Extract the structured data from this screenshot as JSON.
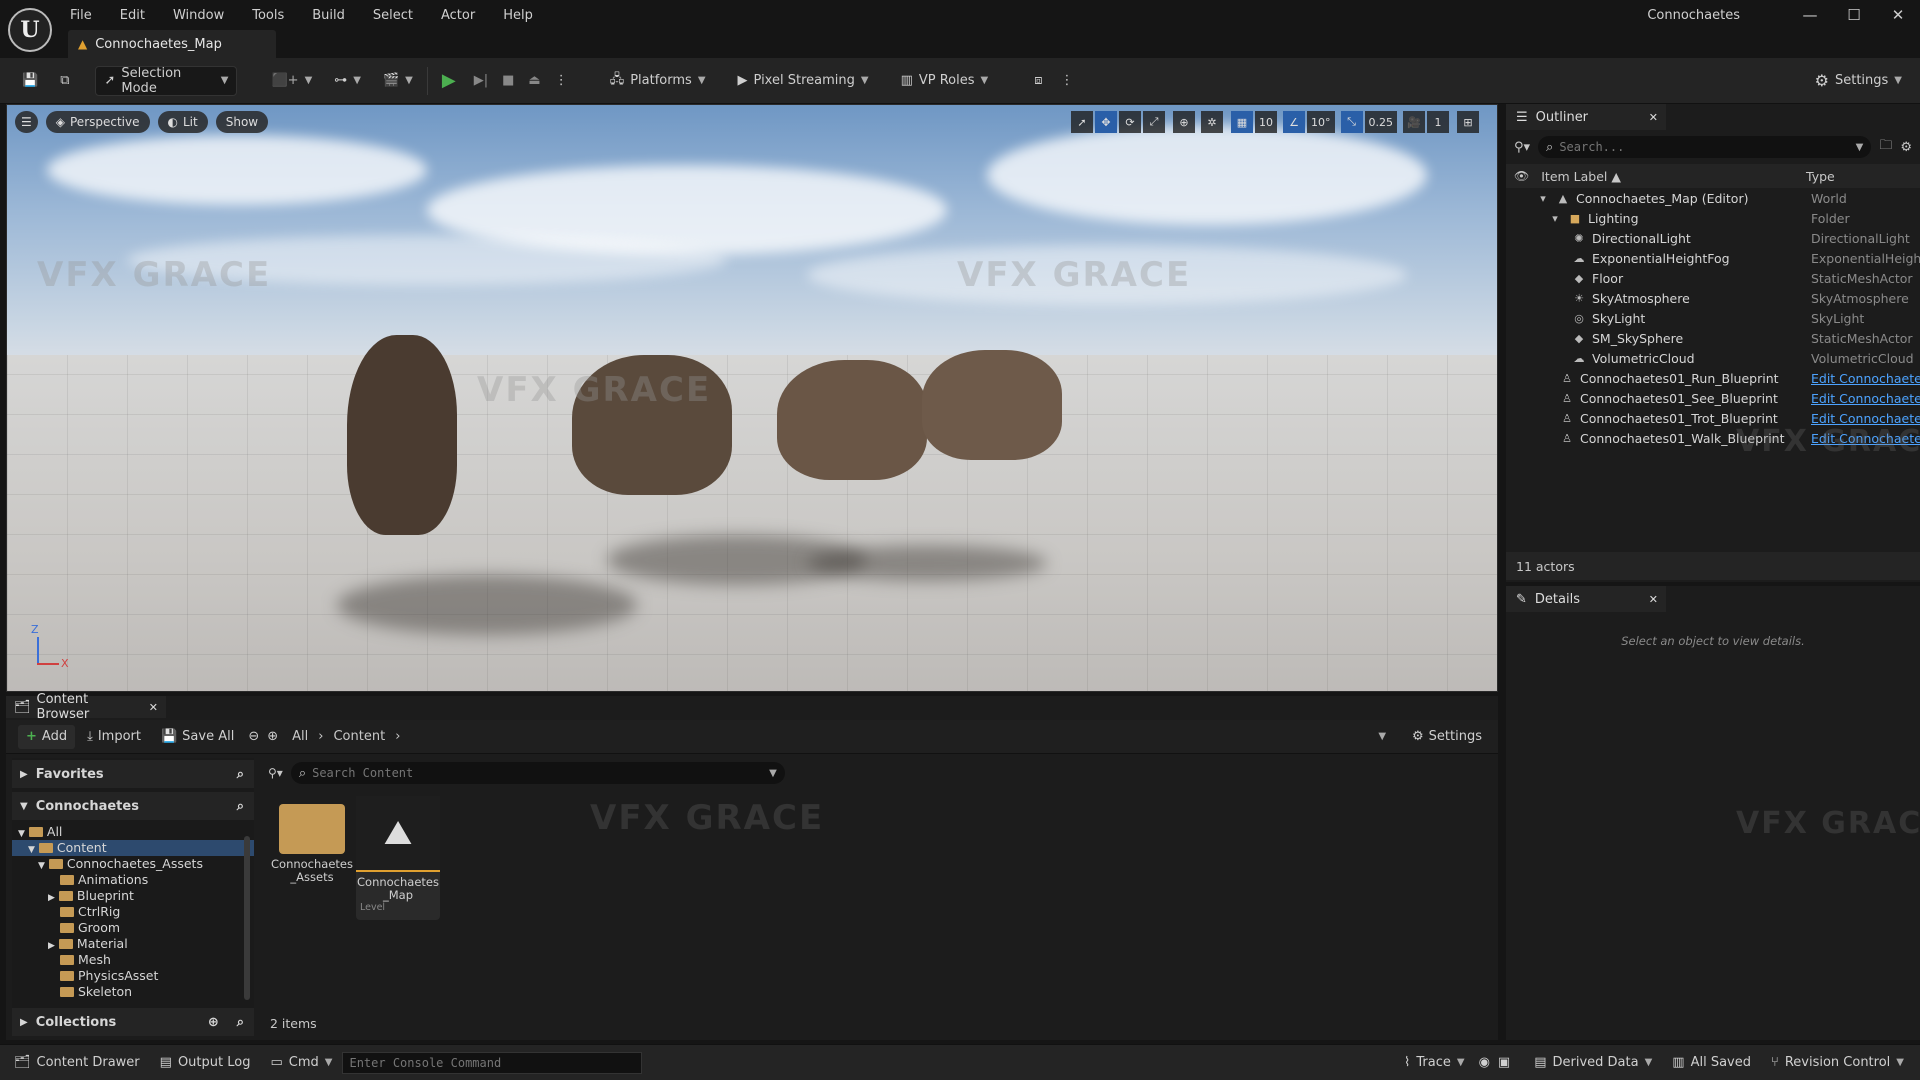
{
  "app": {
    "logo": "U",
    "title": "Connochaetes",
    "map_tab": "Connochaetes_Map",
    "menu": [
      "File",
      "Edit",
      "Window",
      "Tools",
      "Build",
      "Select",
      "Actor",
      "Help"
    ],
    "window_controls": [
      "—",
      "☐",
      "✕"
    ]
  },
  "toolbar": {
    "selection_mode": "Selection Mode",
    "platforms": "Platforms",
    "pixel_streaming": "Pixel Streaming",
    "vp_roles": "VP Roles",
    "settings": "Settings"
  },
  "viewport": {
    "perspective": "Perspective",
    "lit": "Lit",
    "show": "Show",
    "grid_snap": "10",
    "rotation_snap": "10°",
    "scale_snap": "0.25",
    "camera_speed": "1",
    "axis_z": "Z",
    "axis_x": "X",
    "watermark": "VFX GRACE"
  },
  "outliner": {
    "tab": "Outliner",
    "search_placeholder": "Search...",
    "col_label": "Item Label ▲",
    "col_type": "Type",
    "rows": [
      {
        "label": "Connochaetes_Map (Editor)",
        "type": "World"
      },
      {
        "label": "Lighting",
        "type": "Folder"
      },
      {
        "label": "DirectionalLight",
        "type": "DirectionalLight"
      },
      {
        "label": "ExponentialHeightFog",
        "type": "ExponentialHeight"
      },
      {
        "label": "Floor",
        "type": "StaticMeshActor"
      },
      {
        "label": "SkyAtmosphere",
        "type": "SkyAtmosphere"
      },
      {
        "label": "SkyLight",
        "type": "SkyLight"
      },
      {
        "label": "SM_SkySphere",
        "type": "StaticMeshActor"
      },
      {
        "label": "VolumetricCloud",
        "type": "VolumetricCloud"
      },
      {
        "label": "Connochaetes01_Run_Blueprint",
        "type": "Edit Connochaete"
      },
      {
        "label": "Connochaetes01_See_Blueprint",
        "type": "Edit Connochaete"
      },
      {
        "label": "Connochaetes01_Trot_Blueprint",
        "type": "Edit Connochaete"
      },
      {
        "label": "Connochaetes01_Walk_Blueprint",
        "type": "Edit Connochaete"
      }
    ],
    "actor_count": "11 actors"
  },
  "details": {
    "tab": "Details",
    "empty_msg": "Select an object to view details."
  },
  "content_browser": {
    "tab": "Content Browser",
    "add": "Add",
    "import": "Import",
    "save_all": "Save All",
    "path": [
      "All",
      "Content"
    ],
    "settings": "Settings",
    "search_placeholder": "Search Content",
    "favorites": "Favorites",
    "project": "Connochaetes",
    "collections": "Collections",
    "tree": [
      "All",
      "Content",
      "Connochaetes_Assets",
      "Animations",
      "Blueprint",
      "CtrlRig",
      "Groom",
      "Material",
      "Mesh",
      "PhysicsAsset",
      "Skeleton"
    ],
    "assets": [
      {
        "name": "Connochaetes\n_Assets",
        "kind": ""
      },
      {
        "name": "Connochaetes\n_Map",
        "kind": "Level"
      }
    ],
    "item_count": "2 items"
  },
  "statusbar": {
    "content_drawer": "Content Drawer",
    "output_log": "Output Log",
    "cmd": "Cmd",
    "console_placeholder": "Enter Console Command",
    "trace": "Trace",
    "derived_data": "Derived Data",
    "all_saved": "All Saved",
    "revision_control": "Revision Control"
  },
  "colors": {
    "accent": "#2a5fa8",
    "link": "#4da3ff",
    "play": "#4caf50",
    "folder": "#c59a55"
  }
}
